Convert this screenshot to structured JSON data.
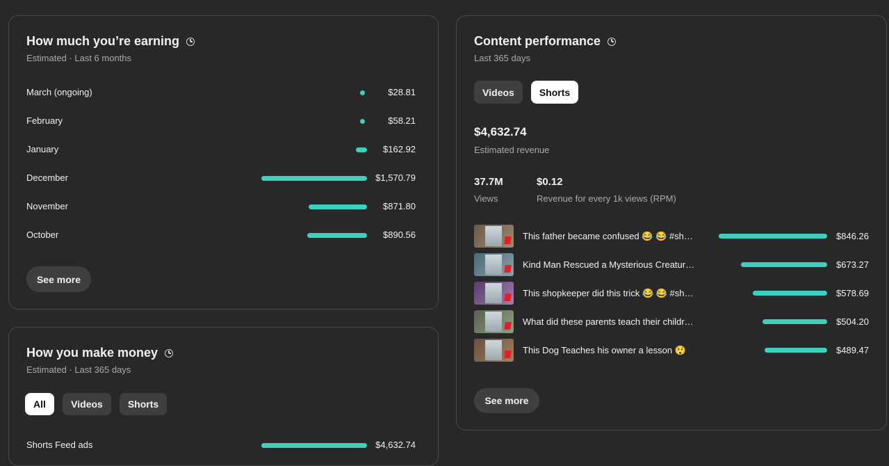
{
  "earning": {
    "title": "How much you’re earning",
    "subtitle": "Estimated · Last 6 months",
    "months": [
      {
        "label": "March (ongoing)",
        "value": "$28.81",
        "amount": 28.81
      },
      {
        "label": "February",
        "value": "$58.21",
        "amount": 58.21
      },
      {
        "label": "January",
        "value": "$162.92",
        "amount": 162.92
      },
      {
        "label": "December",
        "value": "$1,570.79",
        "amount": 1570.79
      },
      {
        "label": "November",
        "value": "$871.80",
        "amount": 871.8
      },
      {
        "label": "October",
        "value": "$890.56",
        "amount": 890.56
      }
    ],
    "see_more": "See more"
  },
  "make_money": {
    "title": "How you make money",
    "subtitle": "Estimated · Last 365 days",
    "filters": [
      "All",
      "Videos",
      "Shorts"
    ],
    "selected_filter": "All",
    "rows": [
      {
        "label": "Shorts Feed ads",
        "value": "$4,632.74",
        "amount": 4632.74
      }
    ]
  },
  "content": {
    "title": "Content performance",
    "subtitle": "Last 365 days",
    "tabs": [
      "Videos",
      "Shorts"
    ],
    "selected_tab": "Shorts",
    "revenue": "$4,632.74",
    "revenue_label": "Estimated revenue",
    "views": "37.7M",
    "views_label": "Views",
    "rpm": "$0.12",
    "rpm_label": "Revenue for every 1k views (RPM)",
    "videos": [
      {
        "title": "This father became confused 😂 😂 #sh…",
        "value": "$846.26",
        "amount": 846.26
      },
      {
        "title": "Kind Man Rescued a Mysterious Creatur…",
        "value": "$673.27",
        "amount": 673.27
      },
      {
        "title": "This shopkeeper did this trick 😂 😂 #sh…",
        "value": "$578.69",
        "amount": 578.69
      },
      {
        "title": "What did these parents teach their childr…",
        "value": "$504.20",
        "amount": 504.2
      },
      {
        "title": "This Dog Teaches his owner a lesson 😲",
        "value": "$489.47",
        "amount": 489.47
      }
    ],
    "see_more": "See more"
  },
  "colors": {
    "bar": "#3ecfbf",
    "background": "#282828",
    "card_border": "#4a4a4a"
  }
}
